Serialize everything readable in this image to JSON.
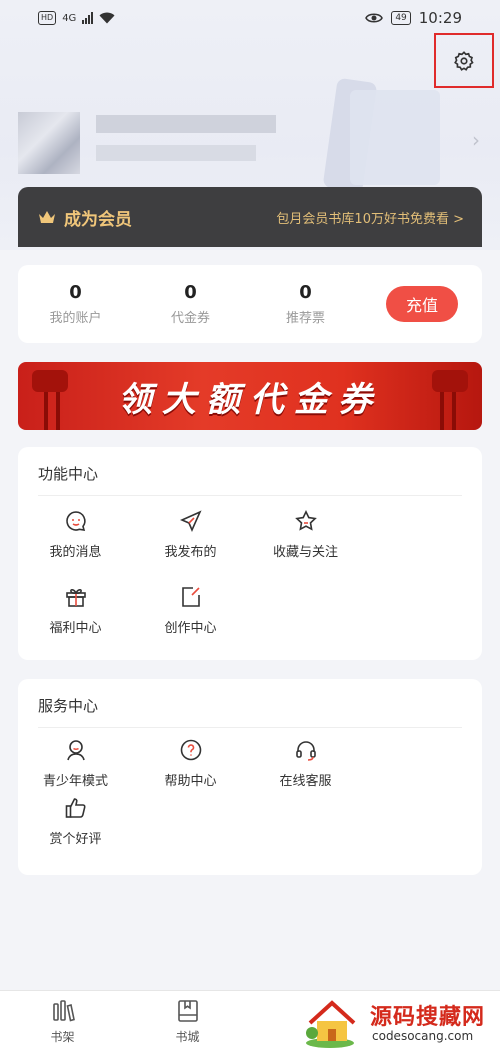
{
  "status_bar": {
    "network": "4G",
    "hd": "HD",
    "battery": "49",
    "time": "10:29"
  },
  "header": {
    "settings_icon": "gear-icon"
  },
  "vip": {
    "title": "成为会员",
    "subtitle": "包月会员书库10万好书免费看 >"
  },
  "account": {
    "items": [
      {
        "value": "0",
        "label": "我的账户"
      },
      {
        "value": "0",
        "label": "代金券"
      },
      {
        "value": "0",
        "label": "推荐票"
      }
    ],
    "recharge_label": "充值"
  },
  "banner": {
    "text": "领大额代金券"
  },
  "function_center": {
    "title": "功能中心",
    "items": [
      {
        "label": "我的消息",
        "icon": "message-icon"
      },
      {
        "label": "我发布的",
        "icon": "paper-plane-icon"
      },
      {
        "label": "收藏与关注",
        "icon": "star-icon"
      },
      {
        "label": "福利中心",
        "icon": "gift-icon"
      },
      {
        "label": "创作中心",
        "icon": "edit-icon"
      }
    ]
  },
  "service_center": {
    "title": "服务中心",
    "items": [
      {
        "label": "青少年模式",
        "icon": "child-icon"
      },
      {
        "label": "帮助中心",
        "icon": "help-icon"
      },
      {
        "label": "在线客服",
        "icon": "headset-icon"
      },
      {
        "label": "赏个好评",
        "icon": "thumbs-up-icon"
      }
    ]
  },
  "tabbar": {
    "items": [
      {
        "label": "书架",
        "icon": "bookshelf-icon"
      },
      {
        "label": "书城",
        "icon": "book-icon"
      }
    ]
  },
  "watermark": {
    "title": "源码搜藏网",
    "url": "codesocang.com"
  },
  "colors": {
    "accent": "#f04f45",
    "vip_gold": "#f0c67a",
    "icon_red": "#e84c3d"
  }
}
